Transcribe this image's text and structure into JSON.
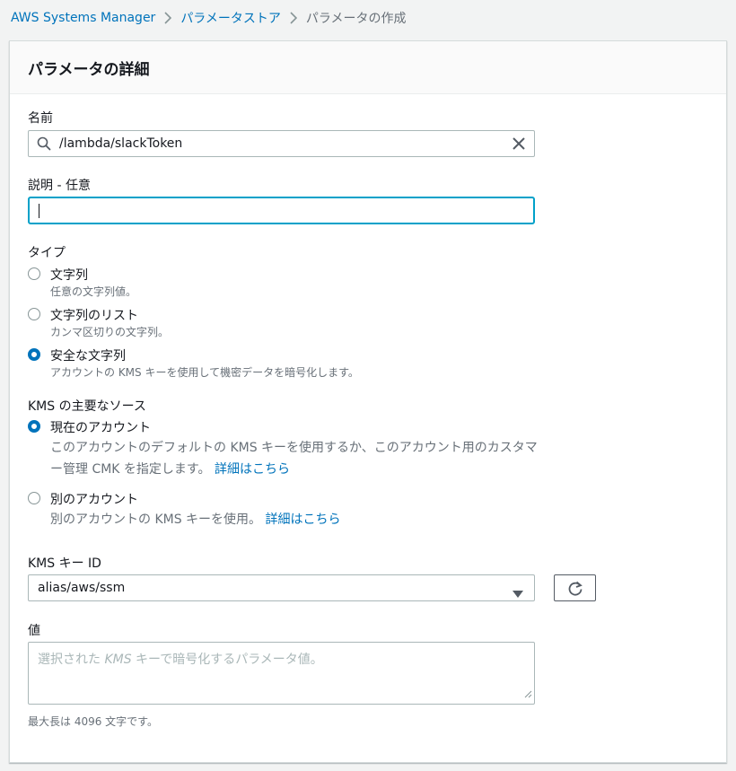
{
  "breadcrumb": {
    "items": [
      "AWS Systems Manager",
      "パラメータストア"
    ],
    "current": "パラメータの作成"
  },
  "panel": {
    "title": "パラメータの詳細"
  },
  "name_field": {
    "label": "名前",
    "value": "/lambda/slackToken"
  },
  "description_field": {
    "label": "説明 - 任意",
    "value": ""
  },
  "type": {
    "label": "タイプ",
    "options": [
      {
        "label": "文字列",
        "description": "任意の文字列値。",
        "checked": false
      },
      {
        "label": "文字列のリスト",
        "description": "カンマ区切りの文字列。",
        "checked": false
      },
      {
        "label": "安全な文字列",
        "description": "アカウントの KMS キーを使用して機密データを暗号化します。",
        "checked": true
      }
    ]
  },
  "kms_source": {
    "label": "KMS の主要なソース",
    "options": [
      {
        "label": "現在のアカウント",
        "description_line1": "このアカウントのデフォルトの KMS キーを使用するか、このアカウント用のカスタマ",
        "description_line2": "ー管理 CMK を指定します。",
        "link": "詳細はこちら",
        "checked": true
      },
      {
        "label": "別のアカウント",
        "description": "別のアカウントの KMS キーを使用。",
        "link": "詳細はこちら",
        "checked": false
      }
    ]
  },
  "kms_key": {
    "label": "KMS キー ID",
    "value": "alias/aws/ssm"
  },
  "value_field": {
    "label": "値",
    "placeholder_before": "選択された ",
    "placeholder_em": "KMS",
    "placeholder_after": " キーで暗号化するパラメータ値。",
    "constraint": "最大長は 4096 文字です。"
  },
  "colors": {
    "link": "#0073bb",
    "focus_border": "#00a1c9",
    "background": "#f2f3f3"
  },
  "icons": {
    "search": "search-icon",
    "clear": "close-icon",
    "dropdown": "caret-down-icon",
    "refresh": "refresh-icon"
  }
}
